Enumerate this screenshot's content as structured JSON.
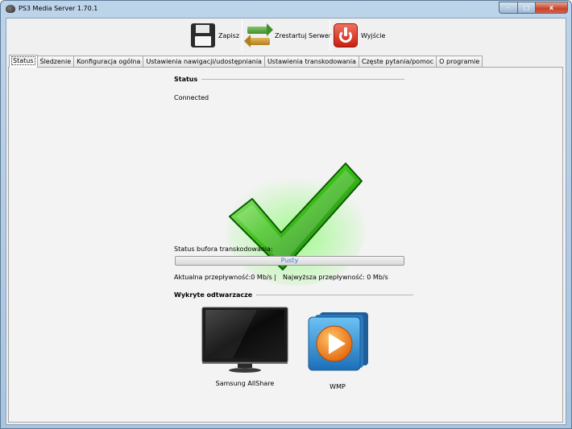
{
  "window": {
    "title": "PS3 Media Server 1.70.1",
    "controls": {
      "minimize": "–",
      "maximize": "□",
      "close": "x"
    }
  },
  "toolbar": {
    "save_label": "Zapisz",
    "restart_label": "Zrestartuj Serwer",
    "exit_label": "Wyjście"
  },
  "tabs": [
    {
      "label": "Status",
      "active": true
    },
    {
      "label": "Śledzenie",
      "active": false
    },
    {
      "label": "Konfiguracja ogólna",
      "active": false
    },
    {
      "label": "Ustawienia nawigacji/udostępniania",
      "active": false
    },
    {
      "label": "Ustawienia transkodowania",
      "active": false
    },
    {
      "label": "Częste pytania/pomoc",
      "active": false
    },
    {
      "label": "O programie",
      "active": false
    }
  ],
  "status": {
    "section_title": "Status",
    "connection": "Connected",
    "buffer_label": "Status bufora transkodowania:",
    "buffer_value_text": "Pusty",
    "buffer_fill_fraction": 0.0,
    "current_rate": "Aktualna przepływność:0 Mb/s",
    "separator": "|",
    "max_rate": "Najwyższa przepływność: 0 Mb/s"
  },
  "players": {
    "section_title": "Wykryte odtwarzacze",
    "items": [
      {
        "name": "Samsung AllShare",
        "icon": "tv-icon"
      },
      {
        "name": "WMP",
        "icon": "wmp-icon"
      }
    ]
  },
  "colors": {
    "check_green": "#3fc21c",
    "progress_text": "#3b7fc4",
    "wmp_orange": "#f28a1e",
    "wmp_blue": "#2f8fd8"
  }
}
